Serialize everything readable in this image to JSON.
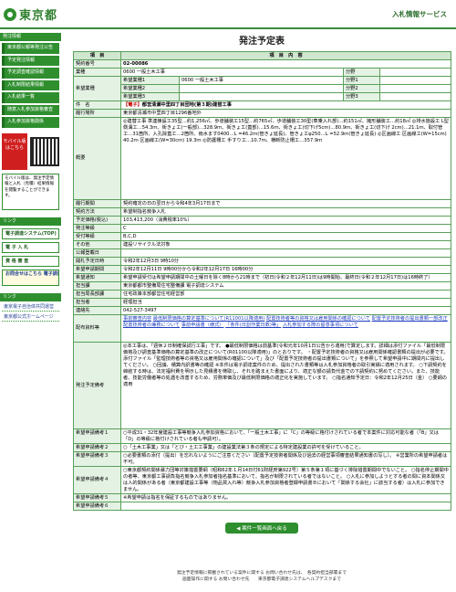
{
  "header": {
    "logo_text": "東京都",
    "site_title": "入札情報サービス"
  },
  "sidebar": {
    "head": "発注情報",
    "items": [
      "東京都公報等発注公告",
      "予定発注情報",
      "予定調査確認情報",
      "入札制限結果情報",
      "入札結果一覧",
      "随意入札参加資格審査",
      "入札参加資格関係"
    ],
    "mobile_label": "モバイル版はこちら",
    "mobile_note": "モバイル版は、発注予定情報と入札（見積）結果情報を閲覧することができます。",
    "head2": "リンク",
    "buttons": [
      "電子調達システム(TOP)",
      "電 子 入 札",
      "資 格 審 査"
    ],
    "blue_button": "お問合せはこちら 電子調達チャットボット",
    "head3": "リンク",
    "links": [
      "東京電子自治体共同運営",
      "東京都公式ホームページ"
    ]
  },
  "main": {
    "page_title": "発注予定表",
    "col_item": "項　目",
    "col_content": "項　目　内　容",
    "rows": {
      "contract_no_label": "契約番号",
      "contract_no": "02-00086",
      "type_label": "業種",
      "type": "0600 一般土木工事",
      "branch_label": "分野",
      "desired_type_label": "希望業種",
      "desired_rows": [
        {
          "name": "希望業種1",
          "value": "0600 一般土木工事",
          "branch": "分野1"
        },
        {
          "name": "希望業種2",
          "value": "",
          "branch": "分野2"
        },
        {
          "name": "希望業種3",
          "value": "",
          "branch": "分野3"
        }
      ],
      "name_label": "件　名",
      "name_tag": "【電子】",
      "name": "都営清瀬中里四丁目団地(第３期)建替工事",
      "place_label": "履行場所",
      "place": "東京都清瀬市中里四丁目1296番地外",
      "summary_label": "概要",
      "summary": "◎建替工事 準連棟設工35型…約1,256㎡、歩道舗装工15型…約765㎡、歩道舗装工30型(車乗入れ部)…約151㎡、擁形舗装工…約18㎡ ◎排水施設工 L型側溝工…54.3ｍ、街きょ工(一般部)…328.9ｍ、街きょ工(蓋部)…15.6ｍ、街きょ工(切下げ5cm)…80.9ｍ、街きょ工(切下げ 2cm)…21.1ｍ、取付管工…31箇所、入孔除蓋工…2箇所、雨水ます0400…L =46.2ｍ(管きょ延長)、管きょ工φ250…L =52.9ｍ(管きょ延長) ◎区画線工 区画線工(W=15cm) 40.2ｍ 区画線工(W=30cm) 19.3ｍ ◎防護柵工 手すり工…10.7ｍ、横断防止柵工…357.9ｍ",
      "period_label": "履行期間",
      "period": "契約確定の日の翌日から令和4年3月17日まで",
      "method_label": "契約方法",
      "method": "希望制指名競争入札",
      "price_label": "予定価格(税込)",
      "price": "103,413,200（消費税率10%）",
      "level_label": "発注等級",
      "level": "C",
      "grade_label": "受付等級",
      "grade": "B,C,D",
      "other_label": "その他",
      "other": "建設リサイクル法対象",
      "notice_label": "公報登載日",
      "notice": "",
      "open_label": "開札予定日時",
      "open": "令和2年12月3日 9時10分",
      "apply_label": "希望申請期間",
      "apply": "令和2年12月11日 9時00分から令和2年12月17日 16時00分",
      "announce_label": "希望通知",
      "announce": "希望申請受付は希望申請期間中の土曜日を除く8時から21時まで（初日(令和２年12月11日)は9時開始、最終日(令和２年12月17日)は16時終了）",
      "office_label": "担当課",
      "office": "東京都都市整備局住宅整備課 電子調達システム",
      "dept_label": "担当局長部課",
      "dept": "住宅政策本部都営住宅経営部",
      "person_label": "担当者",
      "person": "経理担当",
      "tel_label": "連絡先",
      "tel": "042-527-3497",
      "docs_label": "配布資料等",
      "docs": [
        "事前審査内容",
        "最低制限価格の算定基準について(R11001以降適用)",
        "配置技術者等の資格又は雇用関係の確認について",
        "配置予定技術者の提出書類一部改正",
        "配置技術者の兼務について",
        "事前申請書（様式）",
        "「条件(日割作業日数)等」",
        "入札参加する際の留意事項について"
      ],
      "condition_label": "発注予定備考",
      "condition": "◎本工事は、「週休２日制確保試行工事」です。 ●最低制限価格は前基準(令和元年10月1日公告から適用)で算定します。詳細は添付ファイル「最低制限価格及び調査基準価格の算定基準の改正について(R01100以降適用)」のとおりです。 ・配置予定技術者の資格又は雇用関係確認書類の提出が必要です。添付ファイル「監理技術者等の資格又は雇用関係の確認について」及び「配置予定技術者の提出書類について」を参照して希望申請中に期間内に提出してください。 ○回議、積算内訳書等の確認 ※本件は電子調達案件のため、提出された書類等は入札参加資格者の取引実績に適用されます。 ○下請契約を締結する時は、法定福利費を明示した見積書を徴取し、それを踏まえた書面により、適正な額の請負代金での下請契約に努めてください。また、技能者、技能労働者等の処遇を改善するため、労務単価及び最低制限価格の適正化を実施しています。 ○指名通知予定日：令和2年12月25日（金） ○要綱の適用",
      "note_rows": [
        {
          "label": "希望申請備考１",
          "value": "○平成31・32年度建設工事等競争入札参加資格において、「一般土木工事」に「C」の等級に格付けされている者で本案件に対応可能な者（「B」又は「D」の等級に格付けされている者も申請可）。"
        },
        {
          "label": "希望申請備考２",
          "value": "○「土木工事業」又は「とび・土工工事業」の建設業法第３条の規定による特定建設業の許可を受けていること。"
        },
        {
          "label": "希望申請備考３",
          "value": "○必要書類の添付（提出）を忘れないようにご注意ください（配置予定技術者関係及び過去の経営事項審査結果通知書の写し）。 ※営業所の希望申請者は不可。"
        },
        {
          "label": "希望申請備考４",
          "value": "○東京都契約関係暴力団等対策措置要綱（昭和62年１月14日付61財経庶第922号）第５条第１項に基づく排除措置期間中でないこと。 ○指名停止期間中の者等、東京都工事請負指名競争入札参加者指名基準において、指名が制限されている者ではないこと。 ○入札に参加しようとする者の間に資本関係又は人的関係がある者（東京都建設工事等（物品買入れ等）競争入札参加資格者登録申請書Ｂにおいて「関係する会社」に該当する者）は入札に参加できません。"
        },
        {
          "label": "希望申請備考５",
          "value": "※希望申請は指名を保証するものではありません。"
        },
        {
          "label": "希望申請備考６",
          "value": ""
        }
      ]
    },
    "back_button": "◀ 案件一覧画面へ戻る"
  },
  "footer": {
    "line1": "発注予定情報に掲載されている案件に関する お問い合わせ先は、　各契約担当部署まで",
    "line2": "画面操作に関する お問い合わせ先　　東京都電子調達システムヘルプデスクまで"
  }
}
